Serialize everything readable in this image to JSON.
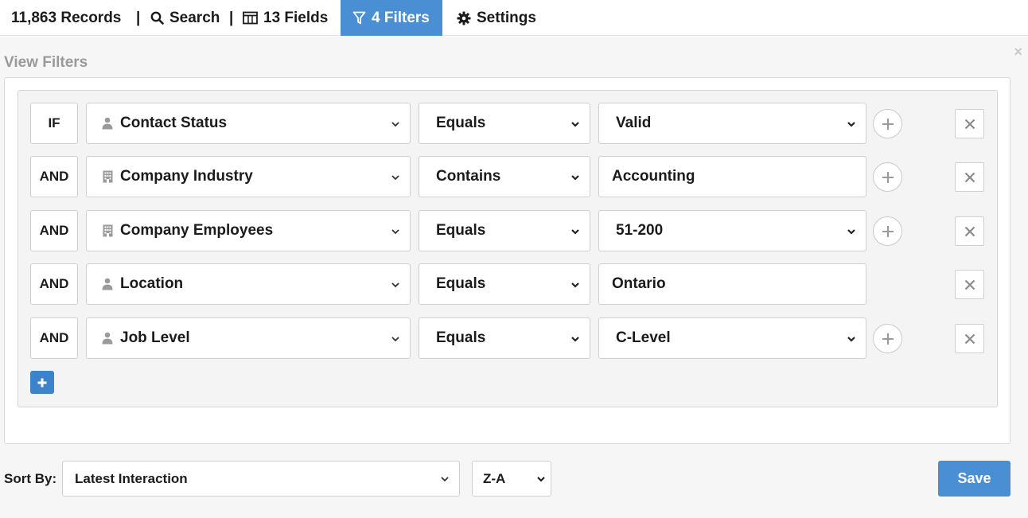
{
  "toolbar": {
    "records": "11,863 Records",
    "sep1": "|",
    "search": "Search",
    "sep2": "|",
    "fields": "13 Fields",
    "filters": "4 Filters",
    "settings": "Settings"
  },
  "panel": {
    "title": "View Filters",
    "close": "×"
  },
  "filters": [
    {
      "connector": "IF",
      "field": "Contact Status",
      "field_icon": "person-icon",
      "operator": "Equals",
      "value": "Valid",
      "value_type": "select",
      "has_plus": true
    },
    {
      "connector": "AND",
      "field": "Company Industry",
      "field_icon": "building-icon",
      "operator": "Contains",
      "value": "Accounting",
      "value_type": "text",
      "has_plus": true
    },
    {
      "connector": "AND",
      "field": "Company Employees",
      "field_icon": "building-icon",
      "operator": "Equals",
      "value": "51-200",
      "value_type": "select",
      "has_plus": true
    },
    {
      "connector": "AND",
      "field": "Location",
      "field_icon": "person-icon",
      "operator": "Equals",
      "value": "Ontario",
      "value_type": "text",
      "has_plus": false
    },
    {
      "connector": "AND",
      "field": "Job Level",
      "field_icon": "person-icon",
      "operator": "Equals",
      "value": "C-Level",
      "value_type": "select",
      "has_plus": true
    }
  ],
  "sort": {
    "label": "Sort By:",
    "field": "Latest Interaction",
    "direction": "Z-A"
  },
  "save_label": "Save",
  "colors": {
    "accent": "#4a8fd4",
    "add_button": "#3c83cc",
    "panel_bg": "#f6f6f6"
  }
}
